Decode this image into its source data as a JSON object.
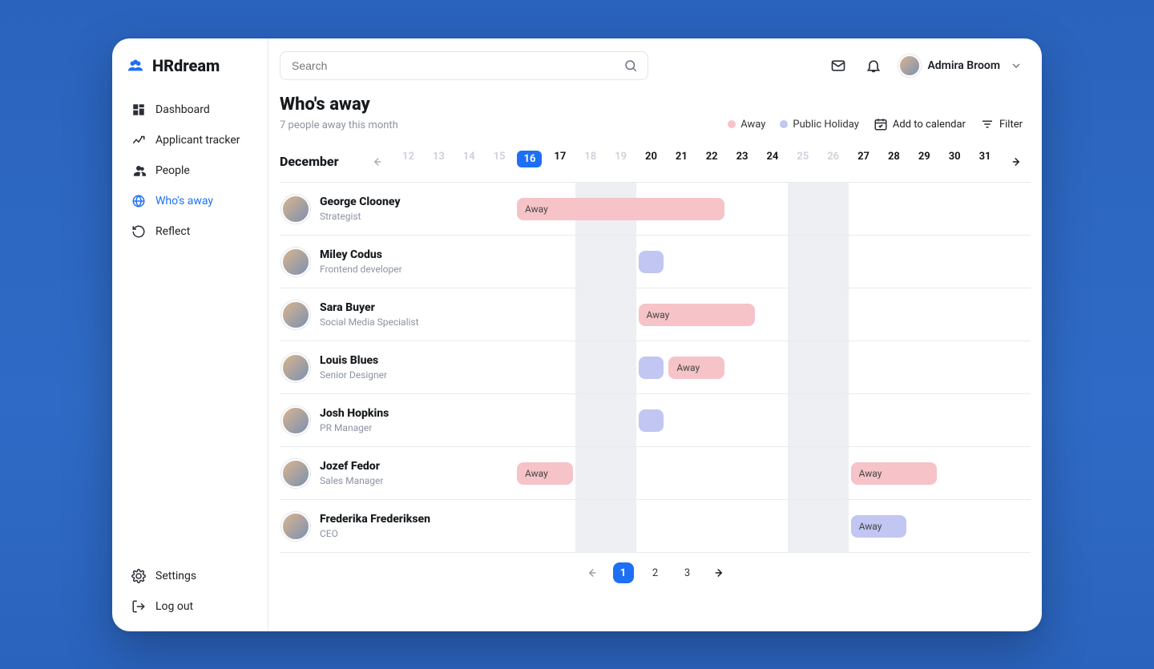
{
  "brand": {
    "name": "HRdream"
  },
  "search": {
    "placeholder": "Search"
  },
  "user": {
    "name": "Admira Broom"
  },
  "sidebar": {
    "items": [
      {
        "label": "Dashboard",
        "icon": "grid"
      },
      {
        "label": "Applicant tracker",
        "icon": "trend"
      },
      {
        "label": "People",
        "icon": "people"
      },
      {
        "label": "Who's away",
        "icon": "globe",
        "active": true
      },
      {
        "label": "Reflect",
        "icon": "restore"
      }
    ],
    "bottom": [
      {
        "label": "Settings",
        "icon": "gear"
      },
      {
        "label": "Log out",
        "icon": "logout"
      }
    ]
  },
  "page": {
    "title": "Who's away",
    "subtitle": "7 people away this month"
  },
  "legend": {
    "away": "Away",
    "holiday": "Public Holiday"
  },
  "actions": {
    "add": "Add to calendar",
    "filter": "Filter"
  },
  "calendar": {
    "month": "December",
    "days": [
      {
        "n": "12",
        "dim": true
      },
      {
        "n": "13",
        "dim": true
      },
      {
        "n": "14",
        "dim": true
      },
      {
        "n": "15",
        "dim": true
      },
      {
        "n": "16",
        "today": true
      },
      {
        "n": "17"
      },
      {
        "n": "18",
        "dim": true
      },
      {
        "n": "19",
        "dim": true
      },
      {
        "n": "20"
      },
      {
        "n": "21"
      },
      {
        "n": "22"
      },
      {
        "n": "23"
      },
      {
        "n": "24"
      },
      {
        "n": "25",
        "dim": true
      },
      {
        "n": "26",
        "dim": true
      },
      {
        "n": "27"
      },
      {
        "n": "28"
      },
      {
        "n": "29"
      },
      {
        "n": "30"
      },
      {
        "n": "31"
      }
    ]
  },
  "people": [
    {
      "name": "George Clooney",
      "role": "Strategist",
      "bars": [
        {
          "type": "pink",
          "label": "Away",
          "start": 4,
          "span": 7
        }
      ]
    },
    {
      "name": "Miley Codus",
      "role": "Frontend developer",
      "bars": [
        {
          "type": "lav",
          "label": "",
          "start": 8,
          "span": 1
        }
      ]
    },
    {
      "name": "Sara Buyer",
      "role": "Social Media Specialist",
      "bars": [
        {
          "type": "pink",
          "label": "Away",
          "start": 8,
          "span": 4
        }
      ]
    },
    {
      "name": "Louis Blues",
      "role": "Senior Designer",
      "bars": [
        {
          "type": "lav",
          "label": "",
          "start": 8,
          "span": 1
        },
        {
          "type": "pink",
          "label": "Away",
          "start": 9,
          "span": 2
        }
      ]
    },
    {
      "name": "Josh Hopkins",
      "role": "PR Manager",
      "bars": [
        {
          "type": "lav",
          "label": "",
          "start": 8,
          "span": 1
        }
      ]
    },
    {
      "name": "Jozef Fedor",
      "role": "Sales Manager",
      "bars": [
        {
          "type": "pink",
          "label": "Away",
          "start": 4,
          "span": 2
        },
        {
          "type": "pink",
          "label": "Away",
          "start": 15,
          "span": 3
        }
      ]
    },
    {
      "name": "Frederika Frederiksen",
      "role": "CEO",
      "bars": [
        {
          "type": "lav",
          "label": "Away",
          "start": 15,
          "span": 2
        }
      ]
    }
  ],
  "pagination": {
    "pages": [
      "1",
      "2",
      "3"
    ],
    "active": 0
  }
}
